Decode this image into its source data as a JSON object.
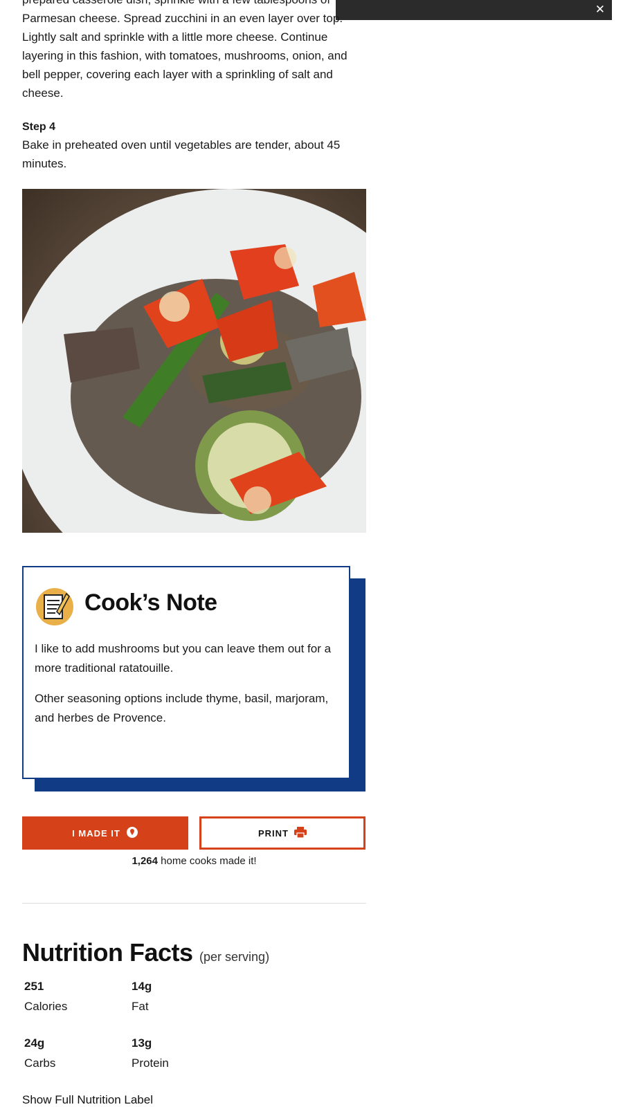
{
  "overlay": {
    "close_label": "✕"
  },
  "step3": {
    "text_line0": "prepared casserole dish, sprinkle with a few tablespoons of",
    "text": "Parmesan cheese. Spread zucchini in an even layer over top. Lightly salt and sprinkle with a little more cheese. Continue layering in this fashion, with tomatoes, mushrooms, onion, and bell pepper, covering each layer with a sprinkling of salt and cheese."
  },
  "step4": {
    "title": "Step 4",
    "text": "Bake in preheated oven until vegetables are tender, about 45 minutes."
  },
  "photo": {
    "alt": "ratatouille-photo"
  },
  "cooks_note": {
    "title": "Cook’s Note",
    "paragraphs": [
      "I like to add mushrooms but you can leave them out for a more traditional ratatouille.",
      "Other seasoning options include thyme, basil, marjoram, and herbes de Provence."
    ],
    "icon": "notepad-pencil-icon",
    "accent_color": "#113b85",
    "icon_bg": "#e9b04a"
  },
  "actions": {
    "made_it_label": "I MADE IT",
    "made_it_icon": "location-pin-icon",
    "print_label": "PRINT",
    "print_icon": "printer-icon",
    "brand_color": "#d54219",
    "made_count": "1,264",
    "made_count_suffix": " home cooks made it!"
  },
  "nutrition": {
    "title": "Nutrition Facts",
    "subtitle": "(per serving)",
    "items": [
      {
        "value": "251",
        "label": "Calories"
      },
      {
        "value": "14g",
        "label": "Fat"
      },
      {
        "value": "24g",
        "label": "Carbs"
      },
      {
        "value": "13g",
        "label": "Protein"
      }
    ],
    "show_full_label": "Show Full Nutrition Label"
  }
}
